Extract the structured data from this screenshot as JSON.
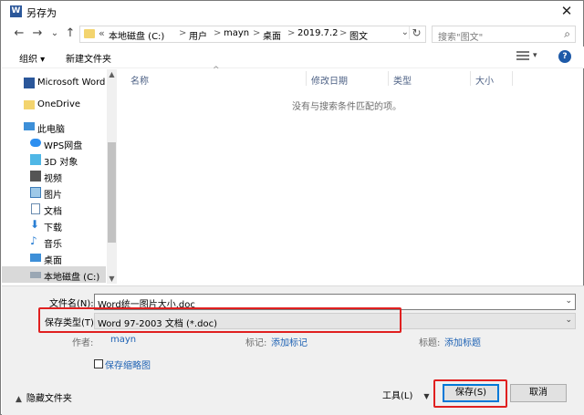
{
  "window": {
    "title": "另存为",
    "app_icon": "W",
    "close_glyph": "✕"
  },
  "nav_buttons": {
    "back": "←",
    "forward": "→",
    "recent": "⌄",
    "up": "↑"
  },
  "address": {
    "chevrons": "«",
    "crumbs": [
      "本地磁盘 (C:)",
      "用户",
      "mayn",
      "桌面",
      "2019.7.2",
      "图文"
    ],
    "separator": ">",
    "dropdown": "⌄",
    "refresh": "↻"
  },
  "search": {
    "placeholder": "搜索\"图文\"",
    "icon": "⌕"
  },
  "toolbar": {
    "organize": "组织 ▾",
    "new_folder": "新建文件夹",
    "view_dropdown": "▾",
    "help": "?"
  },
  "nav": {
    "items": [
      {
        "label": "Microsoft Word",
        "icon": "word-icon"
      },
      {
        "label": "OneDrive",
        "icon": "folder-icon"
      },
      {
        "label": "此电脑",
        "icon": "computer-icon"
      },
      {
        "label": "WPS网盘",
        "icon": "cloud-icon"
      },
      {
        "label": "3D 对象",
        "icon": "cube-icon"
      },
      {
        "label": "视频",
        "icon": "video-icon"
      },
      {
        "label": "图片",
        "icon": "picture-icon"
      },
      {
        "label": "文档",
        "icon": "document-icon"
      },
      {
        "label": "下载",
        "icon": "download-icon"
      },
      {
        "label": "音乐",
        "icon": "music-icon"
      },
      {
        "label": "桌面",
        "icon": "desktop-icon"
      },
      {
        "label": "本地磁盘 (C:)",
        "icon": "drive-icon"
      }
    ],
    "scroll_up": "▲",
    "scroll_down": "▼"
  },
  "file_list": {
    "columns": [
      "名称",
      "修改日期",
      "类型",
      "大小"
    ],
    "sort_indicator": "^",
    "empty_message": "没有与搜索条件匹配的项。"
  },
  "form": {
    "filename_label": "文件名(N):",
    "filename_value": "Word统一图片大小.doc",
    "filetype_label": "保存类型(T):",
    "filetype_value": "Word 97-2003 文档 (*.doc)",
    "dropdown_glyph": "⌄",
    "author_label": "作者:",
    "author_value": "mayn",
    "tags_label": "标记:",
    "tags_value": "添加标记",
    "title_label": "标题:",
    "title_value": "添加标题",
    "thumbnail_label": "保存缩略图"
  },
  "footer": {
    "hide_folders": "隐藏文件夹",
    "hide_caret": "▲",
    "tools": "工具(L)",
    "tools_caret": "▼",
    "save": "保存(S)",
    "cancel": "取消"
  },
  "colors": {
    "highlight_box": "#e02020",
    "accent": "#0078d7",
    "link": "#1e62b4"
  }
}
